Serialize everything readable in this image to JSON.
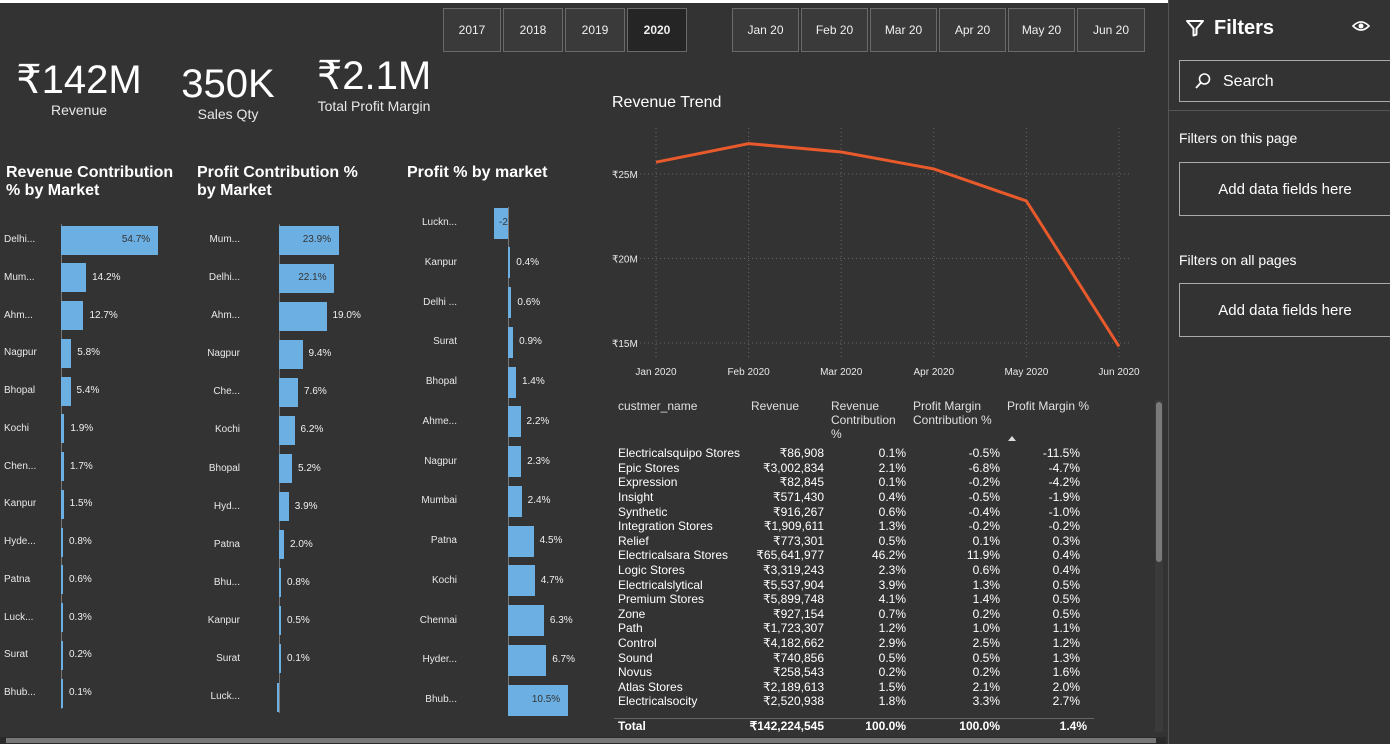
{
  "kpis": [
    {
      "value": "₹142M",
      "label": "Revenue"
    },
    {
      "value": "350K",
      "label": "Sales Qty"
    },
    {
      "value": "₹2.1M",
      "label": "Total Profit Margin"
    }
  ],
  "years": [
    "2017",
    "2018",
    "2019",
    "2020"
  ],
  "selected_year": "2020",
  "months": [
    "Jan 20",
    "Feb 20",
    "Mar 20",
    "Apr 20",
    "May 20",
    "Jun 20"
  ],
  "rev_contrib": {
    "title": "Revenue Contribution % by Market",
    "rows": [
      {
        "m": "Delhi...",
        "v": 54.7,
        "l": "54.7%"
      },
      {
        "m": "Mum...",
        "v": 14.2,
        "l": "14.2%"
      },
      {
        "m": "Ahm...",
        "v": 12.7,
        "l": "12.7%"
      },
      {
        "m": "Nagpur",
        "v": 5.8,
        "l": "5.8%"
      },
      {
        "m": "Bhopal",
        "v": 5.4,
        "l": "5.4%"
      },
      {
        "m": "Kochi",
        "v": 1.9,
        "l": "1.9%"
      },
      {
        "m": "Chen...",
        "v": 1.7,
        "l": "1.7%"
      },
      {
        "m": "Kanpur",
        "v": 1.5,
        "l": "1.5%"
      },
      {
        "m": "Hyde...",
        "v": 0.8,
        "l": "0.8%"
      },
      {
        "m": "Patna",
        "v": 0.6,
        "l": "0.6%"
      },
      {
        "m": "Luck...",
        "v": 0.3,
        "l": "0.3%"
      },
      {
        "m": "Surat",
        "v": 0.2,
        "l": "0.2%"
      },
      {
        "m": "Bhub...",
        "v": 0.1,
        "l": "0.1%"
      }
    ]
  },
  "profit_contrib": {
    "title": "Profit Contribution % by Market",
    "rows": [
      {
        "m": "Mum...",
        "v": 23.9,
        "l": "23.9%"
      },
      {
        "m": "Delhi...",
        "v": 22.1,
        "l": "22.1%"
      },
      {
        "m": "Ahm...",
        "v": 19.0,
        "l": "19.0%"
      },
      {
        "m": "Nagpur",
        "v": 9.4,
        "l": "9.4%"
      },
      {
        "m": "Che...",
        "v": 7.6,
        "l": "7.6%"
      },
      {
        "m": "Kochi",
        "v": 6.2,
        "l": "6.2%"
      },
      {
        "m": "Bhopal",
        "v": 5.2,
        "l": "5.2%"
      },
      {
        "m": "Hyd...",
        "v": 3.9,
        "l": "3.9%"
      },
      {
        "m": "Patna",
        "v": 2.0,
        "l": "2.0%"
      },
      {
        "m": "Bhu...",
        "v": 0.8,
        "l": "0.8%"
      },
      {
        "m": "Kanpur",
        "v": 0.5,
        "l": "0.5%"
      },
      {
        "m": "Surat",
        "v": 0.1,
        "l": "0.1%"
      },
      {
        "m": "Luck...",
        "v": -0.1,
        "l": ""
      }
    ]
  },
  "profit_pct": {
    "title": "Profit % by market",
    "rows": [
      {
        "m": "Luckn...",
        "v": -2.5,
        "l": "-2"
      },
      {
        "m": "Kanpur",
        "v": 0.4,
        "l": "0.4%"
      },
      {
        "m": "Delhi ...",
        "v": 0.6,
        "l": "0.6%"
      },
      {
        "m": "Surat",
        "v": 0.9,
        "l": "0.9%"
      },
      {
        "m": "Bhopal",
        "v": 1.4,
        "l": "1.4%"
      },
      {
        "m": "Ahme...",
        "v": 2.2,
        "l": "2.2%"
      },
      {
        "m": "Nagpur",
        "v": 2.3,
        "l": "2.3%"
      },
      {
        "m": "Mumbai",
        "v": 2.4,
        "l": "2.4%"
      },
      {
        "m": "Patna",
        "v": 4.5,
        "l": "4.5%"
      },
      {
        "m": "Kochi",
        "v": 4.7,
        "l": "4.7%"
      },
      {
        "m": "Chennai",
        "v": 6.3,
        "l": "6.3%"
      },
      {
        "m": "Hyder...",
        "v": 6.7,
        "l": "6.7%"
      },
      {
        "m": "Bhub...",
        "v": 10.5,
        "l": "10.5%"
      }
    ]
  },
  "chart_data": {
    "type": "line",
    "title": "Revenue Trend",
    "x": [
      "Jan 2020",
      "Feb 2020",
      "Mar 2020",
      "Apr 2020",
      "May 2020",
      "Jun 2020"
    ],
    "series": [
      {
        "values": [
          25.7,
          26.8,
          26.3,
          25.3,
          23.4,
          14.8
        ]
      }
    ],
    "yticks": [
      "₹15M",
      "₹20M",
      "₹25M"
    ],
    "ylim": [
      15,
      25
    ],
    "color": "#e8592b",
    "grid": true
  },
  "table": {
    "headers": [
      "custmer_name",
      "Revenue",
      "Revenue Contribution %",
      "Profit Margin Contribution %",
      "Profit Margin %"
    ],
    "rows": [
      [
        "Electricalsquipo Stores",
        "₹86,908",
        "0.1%",
        "-0.5%",
        "-11.5%"
      ],
      [
        "Epic Stores",
        "₹3,002,834",
        "2.1%",
        "-6.8%",
        "-4.7%"
      ],
      [
        "Expression",
        "₹82,845",
        "0.1%",
        "-0.2%",
        "-4.2%"
      ],
      [
        "Insight",
        "₹571,430",
        "0.4%",
        "-0.5%",
        "-1.9%"
      ],
      [
        "Synthetic",
        "₹916,267",
        "0.6%",
        "-0.4%",
        "-1.0%"
      ],
      [
        "Integration Stores",
        "₹1,909,611",
        "1.3%",
        "-0.2%",
        "-0.2%"
      ],
      [
        "Relief",
        "₹773,301",
        "0.5%",
        "0.1%",
        "0.3%"
      ],
      [
        "Electricalsara Stores",
        "₹65,641,977",
        "46.2%",
        "11.9%",
        "0.4%"
      ],
      [
        "Logic Stores",
        "₹3,319,243",
        "2.3%",
        "0.6%",
        "0.4%"
      ],
      [
        "Electricalslytical",
        "₹5,537,904",
        "3.9%",
        "1.3%",
        "0.5%"
      ],
      [
        "Premium Stores",
        "₹5,899,748",
        "4.1%",
        "1.4%",
        "0.5%"
      ],
      [
        "Zone",
        "₹927,154",
        "0.7%",
        "0.2%",
        "0.5%"
      ],
      [
        "Path",
        "₹1,723,307",
        "1.2%",
        "1.0%",
        "1.1%"
      ],
      [
        "Control",
        "₹4,182,662",
        "2.9%",
        "2.5%",
        "1.2%"
      ],
      [
        "Sound",
        "₹740,856",
        "0.5%",
        "0.5%",
        "1.3%"
      ],
      [
        "Novus",
        "₹258,543",
        "0.2%",
        "0.2%",
        "1.6%"
      ],
      [
        "Atlas Stores",
        "₹2,189,613",
        "1.5%",
        "2.1%",
        "2.0%"
      ],
      [
        "Electricalsocity",
        "₹2,520,938",
        "1.8%",
        "3.3%",
        "2.7%"
      ]
    ],
    "total": [
      "Total",
      "₹142,224,545",
      "100.0%",
      "100.0%",
      "1.4%"
    ]
  },
  "filters": {
    "title": "Filters",
    "search": "Search",
    "this_page": "Filters on this page",
    "all_pages": "Filters on all pages",
    "add_fields": "Add data fields here"
  }
}
